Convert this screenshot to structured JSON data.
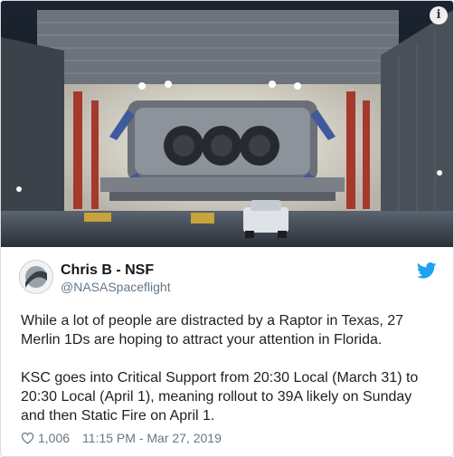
{
  "media": {
    "alt_icon": "info-icon",
    "info_glyph": "i"
  },
  "author": {
    "name": "Chris B - NSF",
    "handle": "@NASASpaceflight",
    "avatar_icon": "avatar-image"
  },
  "tweet": {
    "paragraph_1": "While a lot of people are distracted by a Raptor in Texas, 27 Merlin 1Ds are hoping to attract your attention in Florida.",
    "paragraph_2": "KSC goes into Critical Support from 20:30 Local (March 31) to 20:30 Local (April 1), meaning rollout to 39A likely on Sunday and then Static Fire on April 1."
  },
  "footer": {
    "like_count": "1,006",
    "timestamp": "11:15 PM - Mar 27, 2019"
  },
  "colors": {
    "twitter_blue": "#1da1f2",
    "text_primary": "#1c2022",
    "text_secondary": "#657786"
  }
}
